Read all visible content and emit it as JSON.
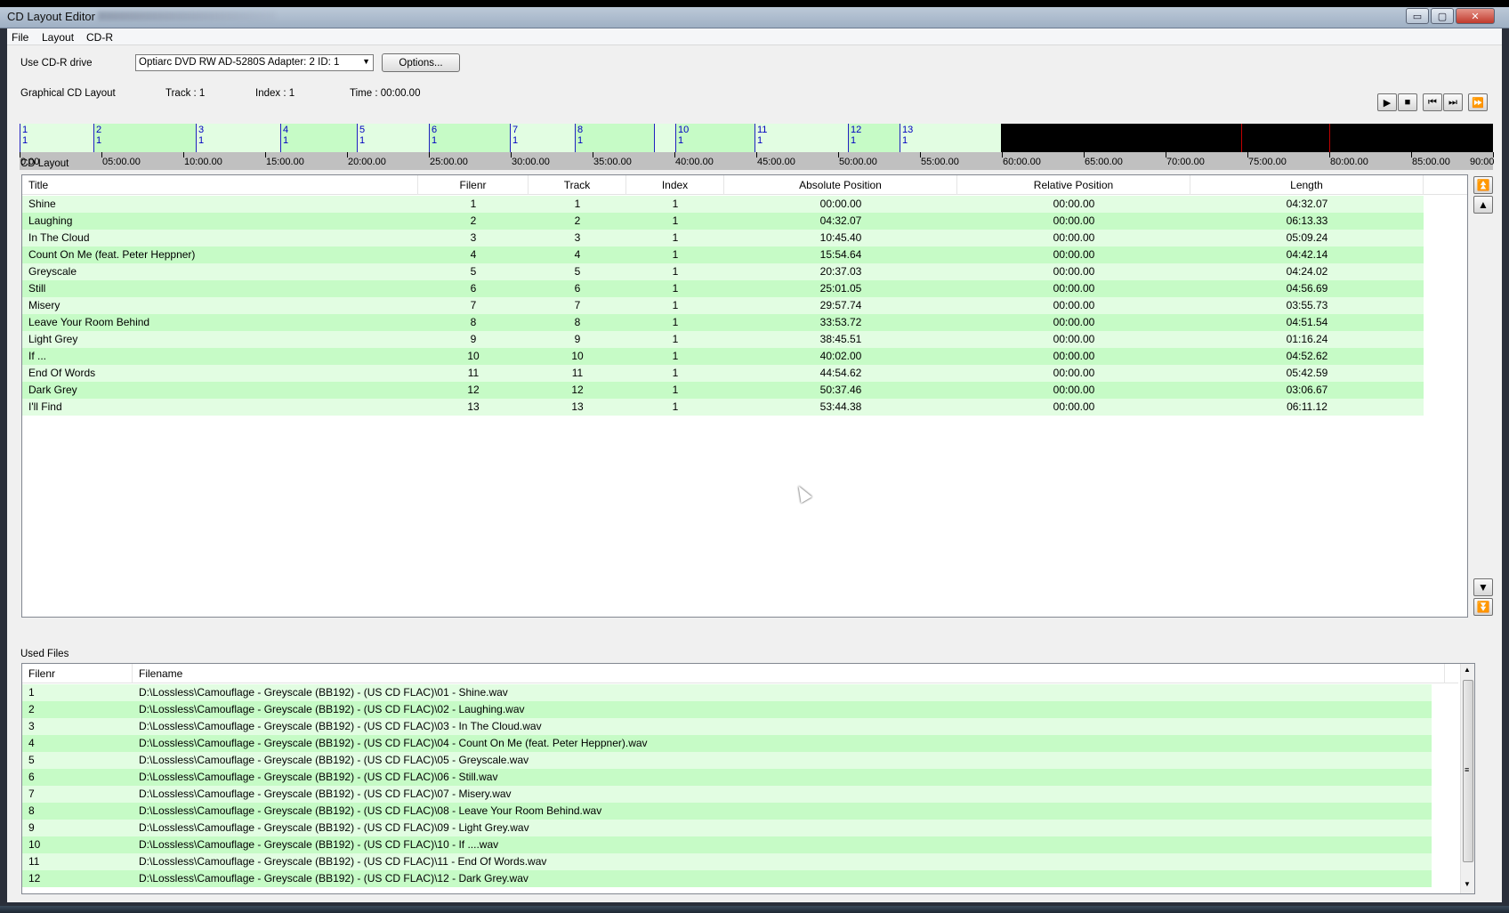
{
  "window": {
    "title": "CD Layout Editor",
    "controls": [
      "▭",
      "▢",
      "✕"
    ]
  },
  "menu": [
    "File",
    "Layout",
    "CD-R"
  ],
  "drive": {
    "label": "Use CD-R drive",
    "selected": "Optiarc DVD RW AD-5280S   Adapter: 2  ID: 1",
    "options_button": "Options..."
  },
  "status": {
    "graphical_label": "Graphical CD Layout",
    "track": "Track : 1",
    "index": "Index : 1",
    "time": "Time :   00:00.00"
  },
  "transport": {
    "play": "▶",
    "stop": "■",
    "prev": "⏮",
    "next": "⏭",
    "forward": "⏩"
  },
  "graphical": {
    "total_minutes": 90,
    "tracks": [
      {
        "track": "1",
        "index": "1",
        "start_min": 0.0
      },
      {
        "track": "2",
        "index": "1",
        "start_min": 4.535
      },
      {
        "track": "3",
        "index": "1",
        "start_min": 10.757
      },
      {
        "track": "4",
        "index": "1",
        "start_min": 15.911
      },
      {
        "track": "5",
        "index": "1",
        "start_min": 20.618
      },
      {
        "track": "6",
        "index": "1",
        "start_min": 25.018
      },
      {
        "track": "7",
        "index": "1",
        "start_min": 29.962
      },
      {
        "track": "8",
        "index": "1",
        "start_min": 33.895
      },
      {
        "track": "",
        "index": "",
        "start_min": 38.757
      },
      {
        "track": "10",
        "index": "1",
        "start_min": 40.033
      },
      {
        "track": "11",
        "index": "1",
        "start_min": 44.91
      },
      {
        "track": "12",
        "index": "1",
        "start_min": 50.624
      },
      {
        "track": "13",
        "index": "1",
        "start_min": 53.74
      }
    ],
    "end_min": 59.93,
    "red_marks_min": [
      74.6,
      80.0
    ],
    "ticks": [
      "0.00",
      "05:00.00",
      "10:00.00",
      "15:00.00",
      "20:00.00",
      "25:00.00",
      "30:00.00",
      "35:00.00",
      "40:00.00",
      "45:00.00",
      "50:00.00",
      "55:00.00",
      "60:00.00",
      "65:00.00",
      "70:00.00",
      "75:00.00",
      "80:00.00",
      "85:00.00",
      "90:00"
    ]
  },
  "layout": {
    "label": "CD Layout",
    "columns": [
      "Title",
      "Filenr",
      "Track",
      "Index",
      "Absolute Position",
      "Relative Position",
      "Length"
    ],
    "rows": [
      [
        "Shine",
        "1",
        "1",
        "1",
        "00:00.00",
        "00:00.00",
        "04:32.07"
      ],
      [
        "Laughing",
        "2",
        "2",
        "1",
        "04:32.07",
        "00:00.00",
        "06:13.33"
      ],
      [
        "In The Cloud",
        "3",
        "3",
        "1",
        "10:45.40",
        "00:00.00",
        "05:09.24"
      ],
      [
        "Count On Me (feat. Peter Heppner)",
        "4",
        "4",
        "1",
        "15:54.64",
        "00:00.00",
        "04:42.14"
      ],
      [
        "Greyscale",
        "5",
        "5",
        "1",
        "20:37.03",
        "00:00.00",
        "04:24.02"
      ],
      [
        "Still",
        "6",
        "6",
        "1",
        "25:01.05",
        "00:00.00",
        "04:56.69"
      ],
      [
        "Misery",
        "7",
        "7",
        "1",
        "29:57.74",
        "00:00.00",
        "03:55.73"
      ],
      [
        "Leave Your Room Behind",
        "8",
        "8",
        "1",
        "33:53.72",
        "00:00.00",
        "04:51.54"
      ],
      [
        "Light Grey",
        "9",
        "9",
        "1",
        "38:45.51",
        "00:00.00",
        "01:16.24"
      ],
      [
        "If ...",
        "10",
        "10",
        "1",
        "40:02.00",
        "00:00.00",
        "04:52.62"
      ],
      [
        "End Of Words",
        "11",
        "11",
        "1",
        "44:54.62",
        "00:00.00",
        "05:42.59"
      ],
      [
        "Dark Grey",
        "12",
        "12",
        "1",
        "50:37.46",
        "00:00.00",
        "03:06.67"
      ],
      [
        "I'll Find",
        "13",
        "13",
        "1",
        "53:44.38",
        "00:00.00",
        "06:11.12"
      ]
    ],
    "side_buttons": [
      "⏫",
      "▲",
      "▼",
      "⏬"
    ]
  },
  "files": {
    "label": "Used Files",
    "columns": [
      "Filenr",
      "Filename"
    ],
    "rows": [
      [
        "1",
        "D:\\Lossless\\Camouflage - Greyscale (BB192) -  (US CD FLAC)\\01 - Shine.wav"
      ],
      [
        "2",
        "D:\\Lossless\\Camouflage - Greyscale (BB192) -  (US CD FLAC)\\02 - Laughing.wav"
      ],
      [
        "3",
        "D:\\Lossless\\Camouflage - Greyscale (BB192) -  (US CD FLAC)\\03 - In The Cloud.wav"
      ],
      [
        "4",
        "D:\\Lossless\\Camouflage - Greyscale (BB192) -  (US CD FLAC)\\04 - Count On Me (feat. Peter Heppner).wav"
      ],
      [
        "5",
        "D:\\Lossless\\Camouflage - Greyscale (BB192) -  (US CD FLAC)\\05 - Greyscale.wav"
      ],
      [
        "6",
        "D:\\Lossless\\Camouflage - Greyscale (BB192) -  (US CD FLAC)\\06 - Still.wav"
      ],
      [
        "7",
        "D:\\Lossless\\Camouflage - Greyscale (BB192) -  (US CD FLAC)\\07 - Misery.wav"
      ],
      [
        "8",
        "D:\\Lossless\\Camouflage - Greyscale (BB192) -  (US CD FLAC)\\08 - Leave Your Room Behind.wav"
      ],
      [
        "9",
        "D:\\Lossless\\Camouflage - Greyscale (BB192) -  (US CD FLAC)\\09 - Light Grey.wav"
      ],
      [
        "10",
        "D:\\Lossless\\Camouflage - Greyscale (BB192) -  (US CD FLAC)\\10 - If ....wav"
      ],
      [
        "11",
        "D:\\Lossless\\Camouflage - Greyscale (BB192) -  (US CD FLAC)\\11 - End Of Words.wav"
      ],
      [
        "12",
        "D:\\Lossless\\Camouflage - Greyscale (BB192) -  (US CD FLAC)\\12 - Dark Grey.wav"
      ]
    ],
    "scroll": {
      "up": "▲",
      "grip": "≡",
      "down": "▼"
    }
  },
  "colors": {
    "row_light": "#e2fde2",
    "row_dark": "#c6fbc6",
    "empty_disc": "#000000",
    "marker": "#2020c0",
    "limit": "#c00000"
  }
}
